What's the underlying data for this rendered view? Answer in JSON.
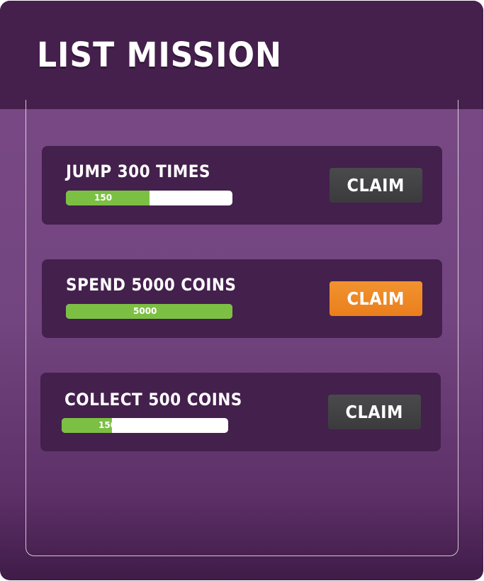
{
  "header": {
    "title": "LIST MISSION"
  },
  "missions": [
    {
      "title": "JUMP 300 TIMES",
      "progress_label": "150",
      "progress_fraction": 0.5,
      "claim_label": "CLAIM",
      "claim_state": "disabled"
    },
    {
      "title": "SPEND 5000 COINS",
      "progress_label": "5000",
      "progress_fraction": 1.0,
      "claim_label": "CLAIM",
      "claim_state": "active"
    },
    {
      "title": "COLLECT 500 COINS",
      "progress_label": "150",
      "progress_fraction": 0.3,
      "claim_label": "CLAIM",
      "claim_state": "disabled"
    }
  ],
  "colors": {
    "header_bg": "#45204d",
    "panel_bg": "#7a4a86",
    "card_bg": "#44204d",
    "progress_fill": "#7cc043",
    "claim_active": "#f1932f",
    "claim_disabled": "#3f3f41"
  }
}
